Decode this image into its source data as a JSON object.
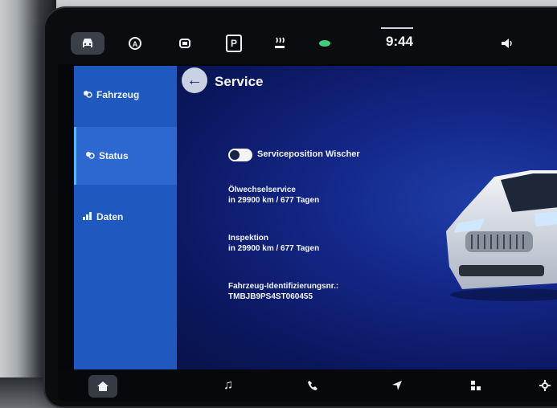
{
  "topbar": {
    "icons": [
      "car-icon",
      "auto-hold-off-icon",
      "driver-assist-icon",
      "parking-icon",
      "seat-heat-icon",
      "eco-leaf-icon"
    ],
    "parking_label": "P",
    "clock": "9:44",
    "volume_icon": "speaker-icon"
  },
  "sidebar": {
    "items": [
      {
        "label": "Fahrzeug",
        "icon": "vehicle-icon"
      },
      {
        "label": "Status",
        "icon": "status-icon"
      },
      {
        "label": "Daten",
        "icon": "data-icon"
      }
    ]
  },
  "main": {
    "title": "Service",
    "toggle": {
      "label": "Serviceposition Wischer",
      "on": false
    },
    "oil_service": {
      "label": "Ölwechselservice",
      "value": "in 29900 km / 677 Tagen"
    },
    "inspection": {
      "label": "Inspektion",
      "value": "in 29900 km / 677 Tagen"
    },
    "vin": {
      "label": "Fahrzeug-Identifizierungsnr.:",
      "value": "TMBJB9PS4ST060455"
    }
  },
  "bottombar": {
    "icons": [
      "home-icon",
      "music-icon",
      "phone-icon",
      "navigation-icon",
      "apps-icon",
      "settings-icon"
    ]
  },
  "colors": {
    "sidebar": "#1f58bf",
    "accent": "#58b6ff",
    "main_bg": "#14288b"
  }
}
